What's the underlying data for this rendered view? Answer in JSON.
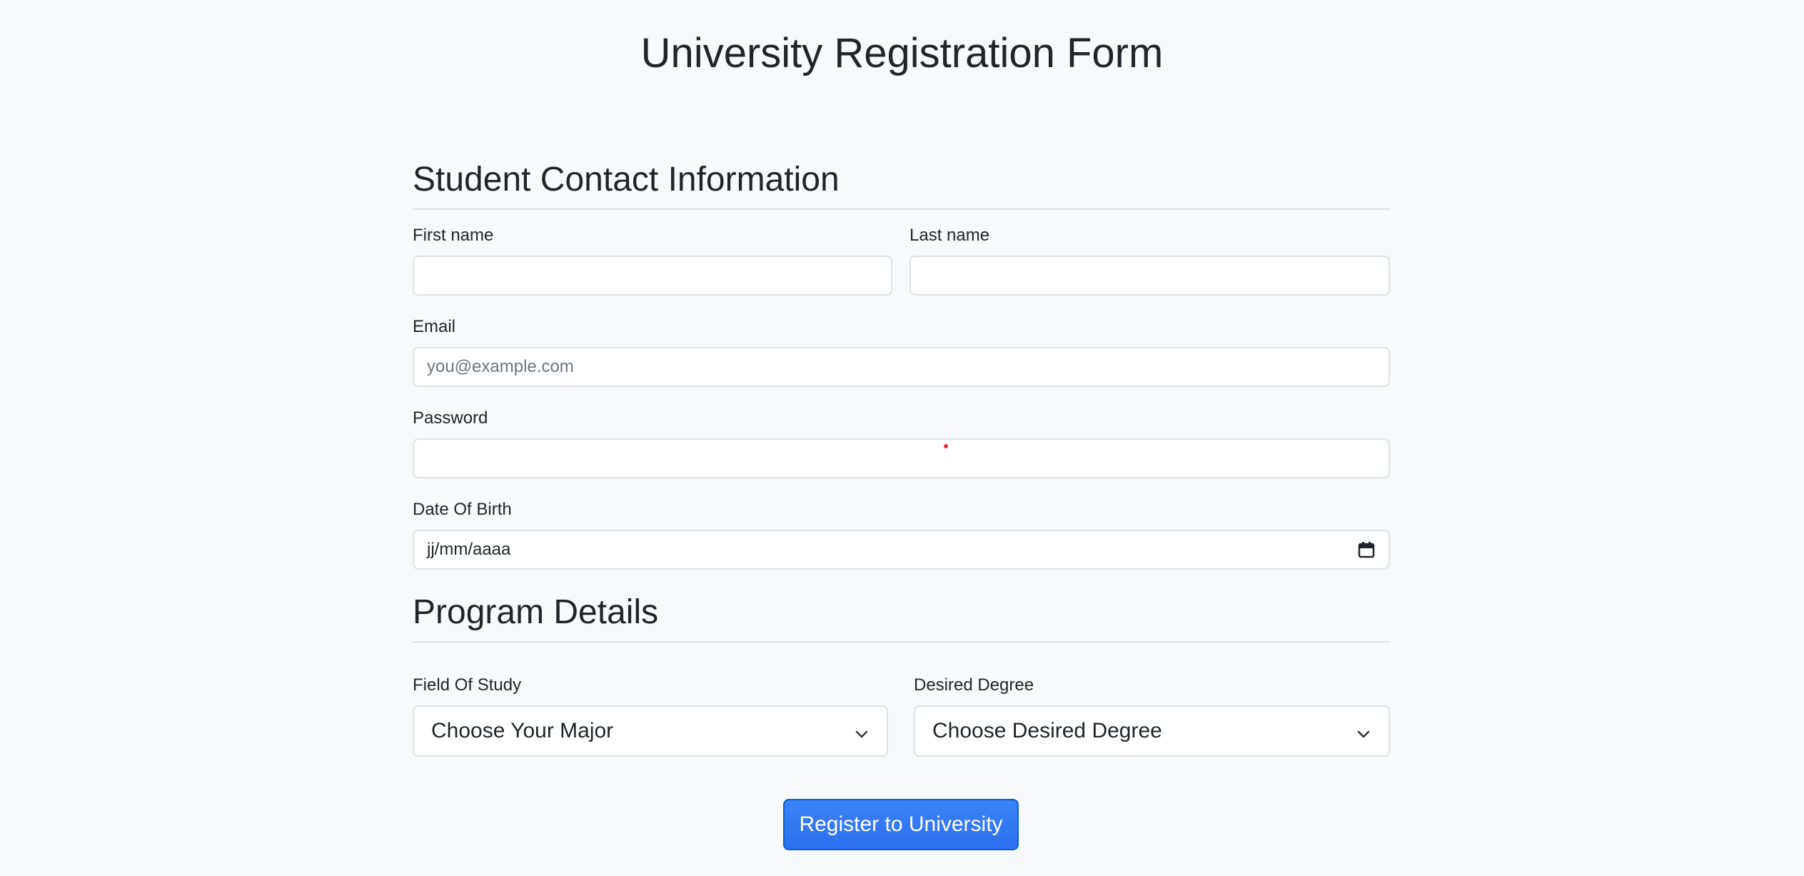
{
  "page": {
    "title": "University Registration Form"
  },
  "contact_section": {
    "heading": "Student Contact Information",
    "first_name": {
      "label": "First name",
      "value": "",
      "placeholder": ""
    },
    "last_name": {
      "label": "Last name",
      "value": "",
      "placeholder": ""
    },
    "email": {
      "label": "Email",
      "value": "",
      "placeholder": "you@example.com"
    },
    "password": {
      "label": "Password",
      "value": "",
      "placeholder": ""
    },
    "date_of_birth": {
      "label": "Date Of Birth",
      "value": "jj/mm/aaaa",
      "icon": "calendar-icon"
    }
  },
  "program_section": {
    "heading": "Program Details",
    "field_of_study": {
      "label": "Field Of Study",
      "selected": "Choose Your Major",
      "icon": "chevron-down-icon"
    },
    "desired_degree": {
      "label": "Desired Degree",
      "selected": "Choose Desired Degree",
      "icon": "chevron-down-icon"
    }
  },
  "submit": {
    "label": "Register to University"
  },
  "colors": {
    "background": "#f8f9fa",
    "primary_button": "#2d6ff0",
    "border": "#dee2e6",
    "text": "#212529"
  }
}
